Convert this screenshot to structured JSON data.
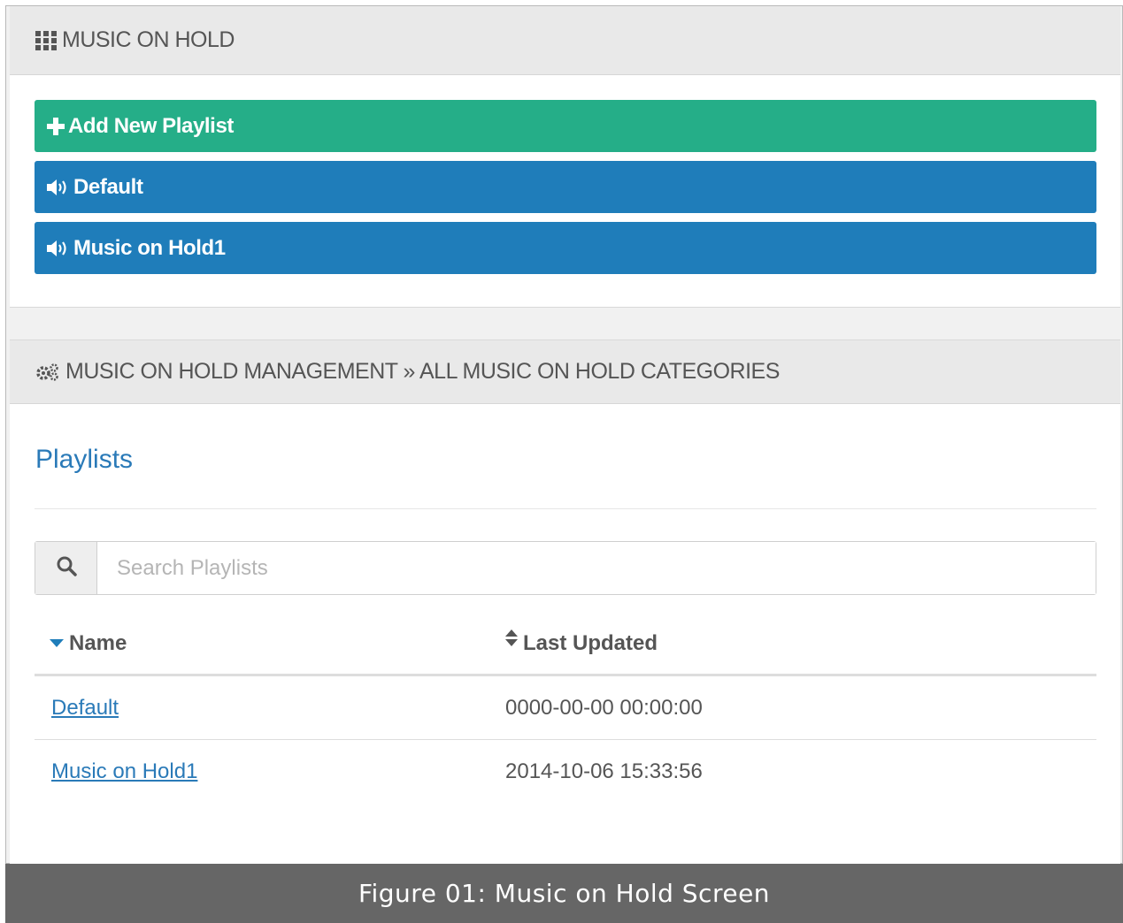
{
  "top_panel": {
    "title": "MUSIC ON HOLD",
    "title_icon": "grid-icon",
    "buttons": [
      {
        "label": "Add New Playlist",
        "icon": "plus-icon",
        "color": "#25ae88"
      },
      {
        "label": "Default",
        "icon": "volume-icon",
        "color": "#1f7dba"
      },
      {
        "label": "Music on Hold1",
        "icon": "volume-icon",
        "color": "#1f7dba"
      }
    ]
  },
  "bottom_panel": {
    "title": "MUSIC ON HOLD MANAGEMENT » ALL MUSIC ON HOLD CATEGORIES",
    "title_icon": "gears-icon",
    "section_title": "Playlists",
    "search": {
      "placeholder": "Search Playlists",
      "value": ""
    },
    "table": {
      "columns": [
        {
          "label": "Name",
          "icon": "caret-down-icon"
        },
        {
          "label": "Last Updated",
          "icon": "sort-icon"
        }
      ],
      "rows": [
        {
          "name": "Default",
          "last_updated": "0000-00-00 00:00:00"
        },
        {
          "name": "Music on Hold1",
          "last_updated": "2014-10-06 15:33:56"
        }
      ]
    }
  },
  "caption": "Figure 01: Music on Hold Screen",
  "colors": {
    "accent_blue": "#1f7dba",
    "accent_green": "#25ae88",
    "link": "#2a7ab8"
  }
}
